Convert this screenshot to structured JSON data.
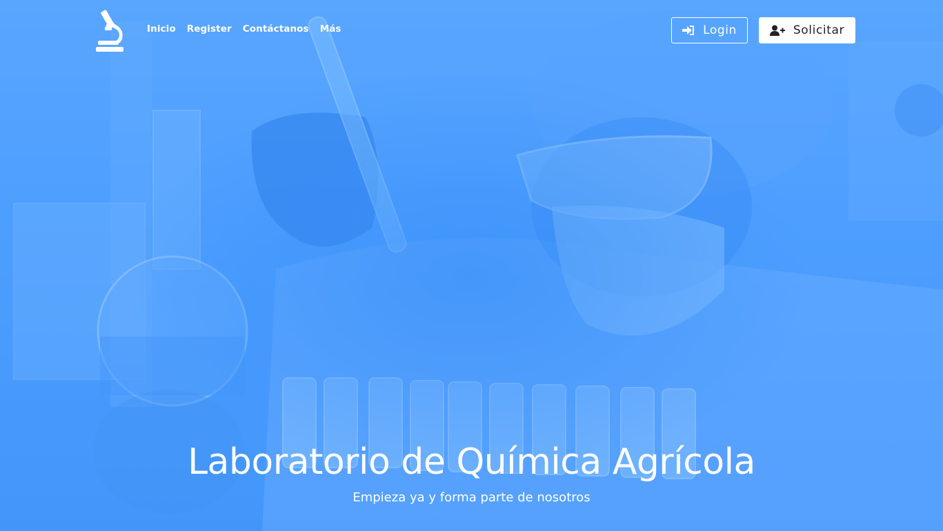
{
  "nav": {
    "brand_icon": "microscope-icon",
    "links": [
      {
        "label": "Inicio"
      },
      {
        "label": "Register"
      },
      {
        "label": "Contáctanos"
      },
      {
        "label": "Más"
      }
    ],
    "login_label": "Login",
    "login_icon": "sign-in-icon",
    "solicitar_label": "Solicitar",
    "solicitar_icon": "user-plus-icon"
  },
  "hero": {
    "title": "Laboratorio de Química Agrícola",
    "subtitle": "Empieza ya y forma parte de nosotros"
  },
  "colors": {
    "accent": "#5aa4ff",
    "text": "#ffffff"
  }
}
